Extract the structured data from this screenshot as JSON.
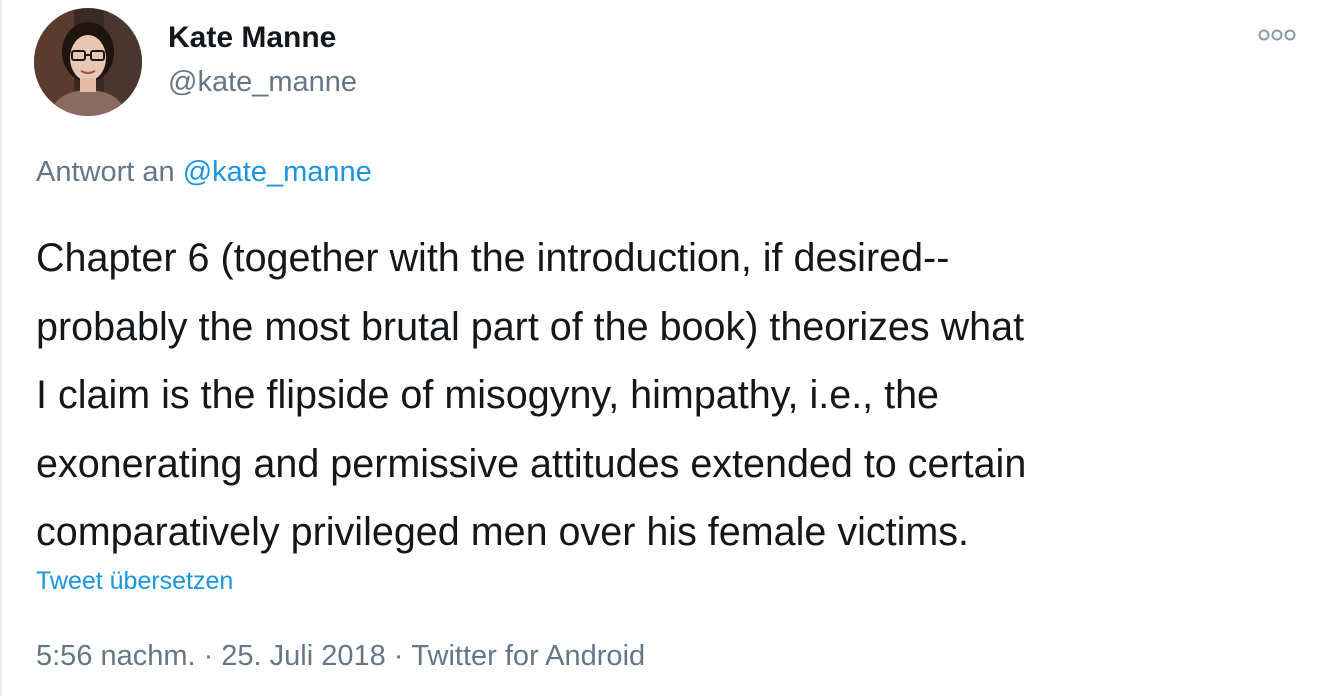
{
  "tweet": {
    "author": {
      "display_name": "Kate Manne",
      "handle": "@kate_manne",
      "avatar_icon": "profile-photo"
    },
    "more_icon": "more-options-icon",
    "reply_to": {
      "prefix": "Antwort an",
      "mention": "@kate_manne"
    },
    "text": "Chapter 6 (together with the introduction, if desired--\nprobably the most brutal part of the book) theorizes what\nI claim is the flipside of misogyny, himpathy, i.e., the\nexonerating and permissive attitudes extended to certain\ncomparatively privileged men over his female victims.",
    "translate_label": "Tweet übersetzen",
    "meta": {
      "time": "5:56 nachm.",
      "separator": "·",
      "date": "25. Juli 2018",
      "source": "Twitter for Android"
    }
  },
  "colors": {
    "text": "#14171a",
    "secondary": "#657786",
    "link": "#1b95e0",
    "border": "#e6ecf0"
  }
}
